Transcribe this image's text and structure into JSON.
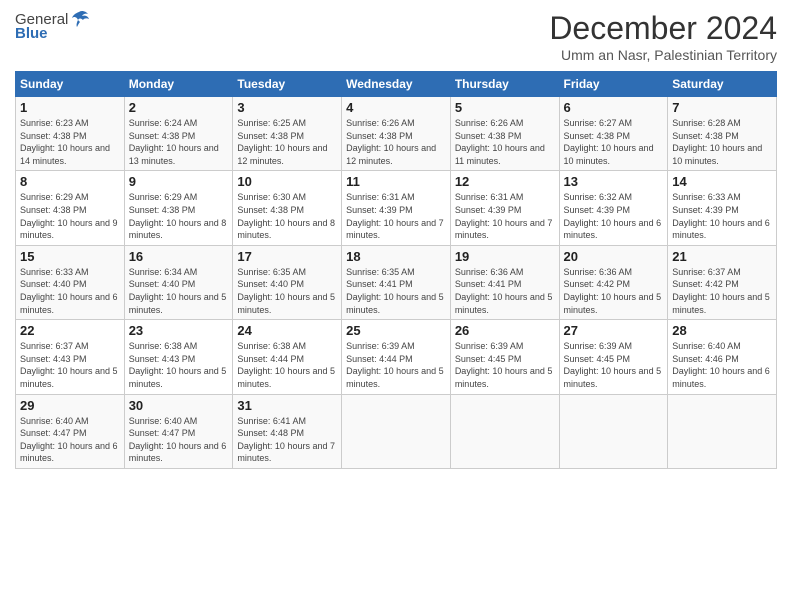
{
  "header": {
    "logo_general": "General",
    "logo_blue": "Blue",
    "title": "December 2024",
    "location": "Umm an Nasr, Palestinian Territory"
  },
  "days_of_week": [
    "Sunday",
    "Monday",
    "Tuesday",
    "Wednesday",
    "Thursday",
    "Friday",
    "Saturday"
  ],
  "weeks": [
    [
      {
        "day": "1",
        "sunrise": "6:23 AM",
        "sunset": "4:38 PM",
        "daylight": "10 hours and 14 minutes."
      },
      {
        "day": "2",
        "sunrise": "6:24 AM",
        "sunset": "4:38 PM",
        "daylight": "10 hours and 13 minutes."
      },
      {
        "day": "3",
        "sunrise": "6:25 AM",
        "sunset": "4:38 PM",
        "daylight": "10 hours and 12 minutes."
      },
      {
        "day": "4",
        "sunrise": "6:26 AM",
        "sunset": "4:38 PM",
        "daylight": "10 hours and 12 minutes."
      },
      {
        "day": "5",
        "sunrise": "6:26 AM",
        "sunset": "4:38 PM",
        "daylight": "10 hours and 11 minutes."
      },
      {
        "day": "6",
        "sunrise": "6:27 AM",
        "sunset": "4:38 PM",
        "daylight": "10 hours and 10 minutes."
      },
      {
        "day": "7",
        "sunrise": "6:28 AM",
        "sunset": "4:38 PM",
        "daylight": "10 hours and 10 minutes."
      }
    ],
    [
      {
        "day": "8",
        "sunrise": "6:29 AM",
        "sunset": "4:38 PM",
        "daylight": "10 hours and 9 minutes."
      },
      {
        "day": "9",
        "sunrise": "6:29 AM",
        "sunset": "4:38 PM",
        "daylight": "10 hours and 8 minutes."
      },
      {
        "day": "10",
        "sunrise": "6:30 AM",
        "sunset": "4:38 PM",
        "daylight": "10 hours and 8 minutes."
      },
      {
        "day": "11",
        "sunrise": "6:31 AM",
        "sunset": "4:39 PM",
        "daylight": "10 hours and 7 minutes."
      },
      {
        "day": "12",
        "sunrise": "6:31 AM",
        "sunset": "4:39 PM",
        "daylight": "10 hours and 7 minutes."
      },
      {
        "day": "13",
        "sunrise": "6:32 AM",
        "sunset": "4:39 PM",
        "daylight": "10 hours and 6 minutes."
      },
      {
        "day": "14",
        "sunrise": "6:33 AM",
        "sunset": "4:39 PM",
        "daylight": "10 hours and 6 minutes."
      }
    ],
    [
      {
        "day": "15",
        "sunrise": "6:33 AM",
        "sunset": "4:40 PM",
        "daylight": "10 hours and 6 minutes."
      },
      {
        "day": "16",
        "sunrise": "6:34 AM",
        "sunset": "4:40 PM",
        "daylight": "10 hours and 5 minutes."
      },
      {
        "day": "17",
        "sunrise": "6:35 AM",
        "sunset": "4:40 PM",
        "daylight": "10 hours and 5 minutes."
      },
      {
        "day": "18",
        "sunrise": "6:35 AM",
        "sunset": "4:41 PM",
        "daylight": "10 hours and 5 minutes."
      },
      {
        "day": "19",
        "sunrise": "6:36 AM",
        "sunset": "4:41 PM",
        "daylight": "10 hours and 5 minutes."
      },
      {
        "day": "20",
        "sunrise": "6:36 AM",
        "sunset": "4:42 PM",
        "daylight": "10 hours and 5 minutes."
      },
      {
        "day": "21",
        "sunrise": "6:37 AM",
        "sunset": "4:42 PM",
        "daylight": "10 hours and 5 minutes."
      }
    ],
    [
      {
        "day": "22",
        "sunrise": "6:37 AM",
        "sunset": "4:43 PM",
        "daylight": "10 hours and 5 minutes."
      },
      {
        "day": "23",
        "sunrise": "6:38 AM",
        "sunset": "4:43 PM",
        "daylight": "10 hours and 5 minutes."
      },
      {
        "day": "24",
        "sunrise": "6:38 AM",
        "sunset": "4:44 PM",
        "daylight": "10 hours and 5 minutes."
      },
      {
        "day": "25",
        "sunrise": "6:39 AM",
        "sunset": "4:44 PM",
        "daylight": "10 hours and 5 minutes."
      },
      {
        "day": "26",
        "sunrise": "6:39 AM",
        "sunset": "4:45 PM",
        "daylight": "10 hours and 5 minutes."
      },
      {
        "day": "27",
        "sunrise": "6:39 AM",
        "sunset": "4:45 PM",
        "daylight": "10 hours and 5 minutes."
      },
      {
        "day": "28",
        "sunrise": "6:40 AM",
        "sunset": "4:46 PM",
        "daylight": "10 hours and 6 minutes."
      }
    ],
    [
      {
        "day": "29",
        "sunrise": "6:40 AM",
        "sunset": "4:47 PM",
        "daylight": "10 hours and 6 minutes."
      },
      {
        "day": "30",
        "sunrise": "6:40 AM",
        "sunset": "4:47 PM",
        "daylight": "10 hours and 6 minutes."
      },
      {
        "day": "31",
        "sunrise": "6:41 AM",
        "sunset": "4:48 PM",
        "daylight": "10 hours and 7 minutes."
      },
      null,
      null,
      null,
      null
    ]
  ]
}
